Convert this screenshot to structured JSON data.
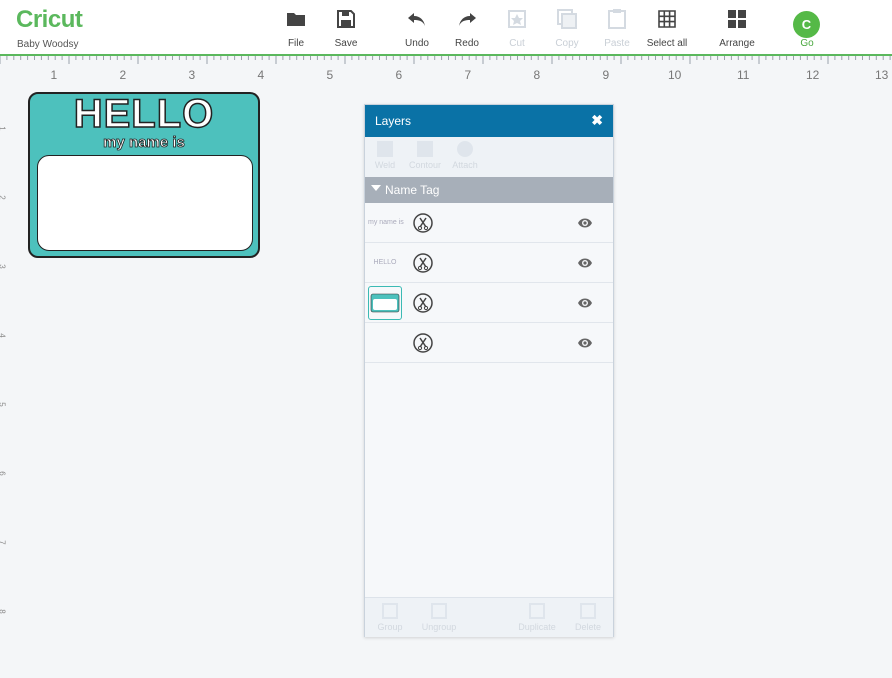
{
  "app": {
    "logo": "Cricut",
    "project_name": "Baby Woodsy"
  },
  "toolbar": {
    "file": "File",
    "save": "Save",
    "undo": "Undo",
    "redo": "Redo",
    "cut": "Cut",
    "copy": "Copy",
    "paste": "Paste",
    "select_all": "Select all",
    "arrange": "Arrange",
    "go_badge": "C",
    "go": "Go"
  },
  "ruler": {
    "numbers": [
      "1",
      "2",
      "3",
      "4",
      "5",
      "6",
      "7",
      "8",
      "9",
      "10",
      "11",
      "12",
      "13"
    ],
    "v_numbers": [
      "1",
      "2",
      "3",
      "4",
      "5",
      "6",
      "7",
      "8"
    ]
  },
  "canvas": {
    "hello": "HELLO",
    "subtitle": "my name is"
  },
  "layers_panel": {
    "title": "Layers",
    "close": "✖",
    "tools": {
      "weld": "Weld",
      "contour": "Contour",
      "attach": "Attach"
    },
    "group_name": "Name Tag",
    "rows": [
      {
        "thumb_text": "my name is"
      },
      {
        "thumb_text": "HELLO"
      },
      {
        "thumb_text": ""
      },
      {
        "thumb_text": ""
      }
    ],
    "footer": {
      "group": "Group",
      "ungroup": "Ungroup",
      "duplicate": "Duplicate",
      "delete": "Delete"
    }
  },
  "colors": {
    "brand_green": "#5bb85d",
    "panel_header": "#0a72a6",
    "tag_teal": "#4dc1bd"
  }
}
